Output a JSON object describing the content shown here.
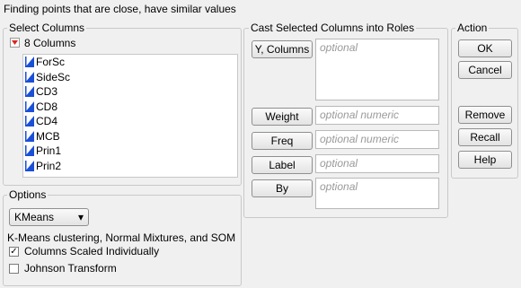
{
  "header": {
    "description": "Finding points that are close, have similar values"
  },
  "select_columns": {
    "title": "Select Columns",
    "count_label": "8 Columns",
    "columns": [
      "ForSc",
      "SideSc",
      "CD3",
      "CD8",
      "CD4",
      "MCB",
      "Prin1",
      "Prin2"
    ]
  },
  "options": {
    "title": "Options",
    "method_select": "KMeans",
    "method_description": "K-Means clustering, Normal Mixtures, and SOM",
    "columns_scaled_label": "Columns Scaled Individually",
    "columns_scaled_checked": true,
    "johnson_label": "Johnson Transform",
    "johnson_checked": false
  },
  "roles": {
    "title": "Cast Selected Columns into Roles",
    "y_columns": {
      "label": "Y, Columns",
      "placeholder": "optional"
    },
    "weight": {
      "label": "Weight",
      "placeholder": "optional numeric"
    },
    "freq": {
      "label": "Freq",
      "placeholder": "optional numeric"
    },
    "label": {
      "label": "Label",
      "placeholder": "optional"
    },
    "by": {
      "label": "By",
      "placeholder": "optional"
    }
  },
  "action": {
    "title": "Action",
    "ok": "OK",
    "cancel": "Cancel",
    "remove": "Remove",
    "recall": "Recall",
    "help": "Help"
  },
  "colors": {
    "column_icon": "#1a4fd6",
    "disclosure": "#d9261c",
    "group_border": "#c9c9c9"
  }
}
